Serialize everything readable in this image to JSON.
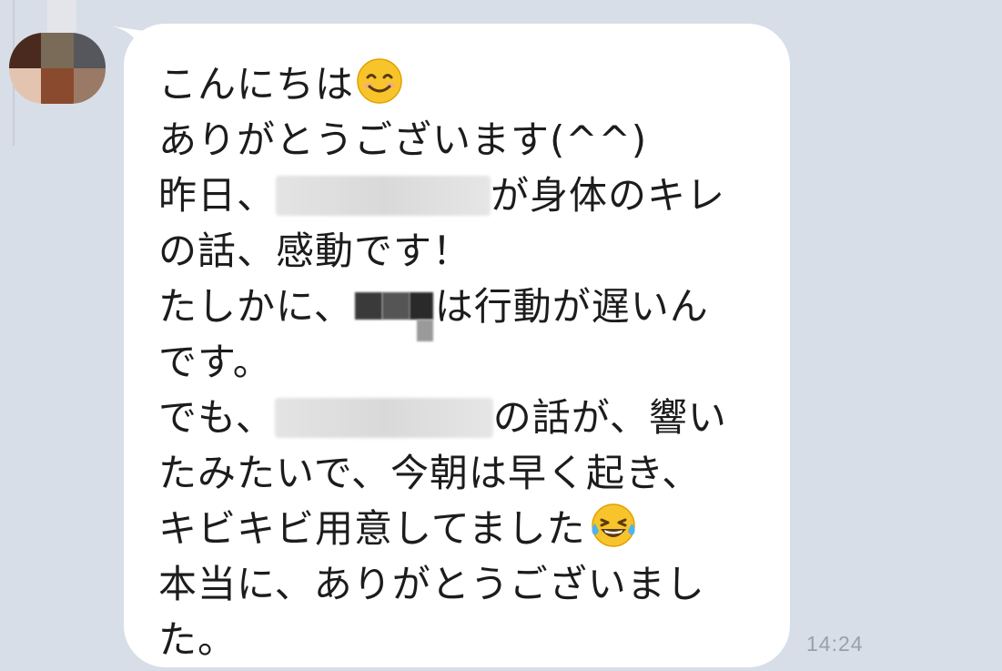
{
  "chat": {
    "message": {
      "lines": [
        "こんにちは",
        "ありがとうございます(^^)",
        "昨日、",
        "が身体のキレ",
        "の話、感動です！",
        "たしかに、",
        "は行動が遅いん",
        "です。",
        "でも、",
        "の話が、響い",
        "たみたいで、今朝は早く起き、",
        "キビキビ用意してました",
        "本当に、ありがとうございまし",
        "た。"
      ],
      "emojis": {
        "greeting": "smiling-face-emoji",
        "laugh": "tears-of-joy-emoji"
      },
      "redactions": [
        "blurred-name",
        "blurred-name",
        "blurred-name"
      ]
    },
    "timestamp": "14:24"
  },
  "colors": {
    "background": "#d8dee8",
    "bubble": "#ffffff",
    "text": "#1c1c1c",
    "timestamp": "#9aa0a8"
  }
}
